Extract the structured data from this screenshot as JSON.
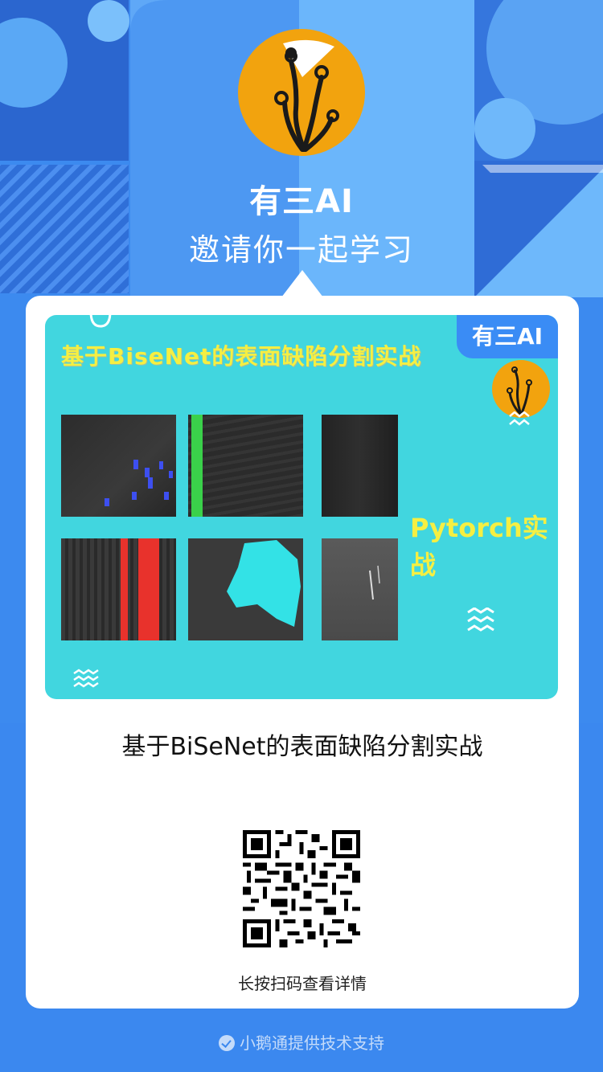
{
  "header": {
    "brand_name": "有三AI",
    "invite_text": "邀请你一起学习"
  },
  "cover": {
    "title": "基于BiseNet的表面缺陷分割实战",
    "badge": "有三AI",
    "subtitle": "Pytorch实战"
  },
  "card": {
    "caption": "基于BiSeNet的表面缺陷分割实战",
    "qr_hint": "长按扫码查看详情"
  },
  "footer": {
    "text": "小鹅通提供技术支持"
  },
  "colors": {
    "background": "#3b88ef",
    "brand_orange": "#f2a30e",
    "cover_cyan": "#41d6df",
    "cover_yellow": "#f5ef42"
  }
}
